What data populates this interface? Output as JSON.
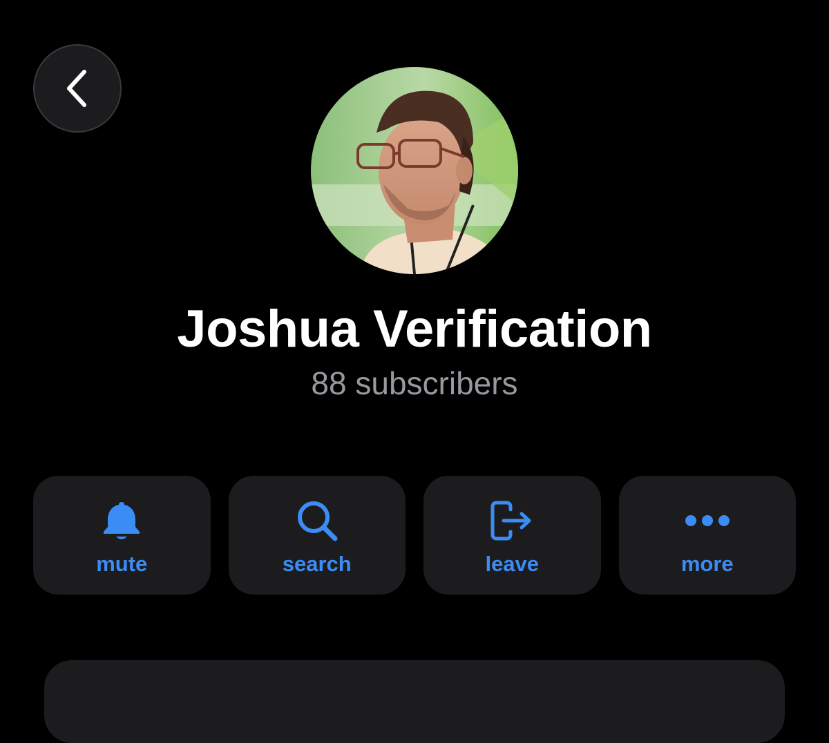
{
  "header": {
    "back_icon": "chevron-left-icon"
  },
  "profile": {
    "avatar_icon": "profile-photo",
    "name": "Joshua Verification",
    "subscribers": "88 subscribers"
  },
  "actions": [
    {
      "icon": "bell-icon",
      "label": "mute"
    },
    {
      "icon": "search-icon",
      "label": "search"
    },
    {
      "icon": "leave-icon",
      "label": "leave"
    },
    {
      "icon": "ellipsis-icon",
      "label": "more"
    }
  ],
  "colors": {
    "background": "#000000",
    "surface": "#1c1c1e",
    "accent": "#3b8cf5",
    "secondary_text": "#98989f"
  }
}
